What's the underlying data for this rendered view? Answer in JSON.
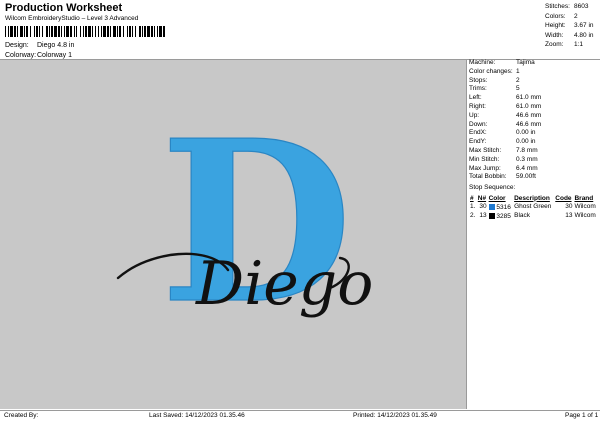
{
  "header": {
    "title": "Production Worksheet",
    "subtitle": "Wilcom EmbroideryStudio – Level 3 Advanced",
    "design_label": "Design:",
    "design_value": "Diego 4.8 in",
    "colorway_label": "Colorway:",
    "colorway_value": "Colorway 1"
  },
  "summary": [
    {
      "label": "Stitches:",
      "value": "8603"
    },
    {
      "label": "Colors:",
      "value": "2"
    },
    {
      "label": "Height:",
      "value": "3.67 in"
    },
    {
      "label": "Width:",
      "value": "4.80 in"
    },
    {
      "label": "Zoom:",
      "value": "1:1"
    }
  ],
  "details": [
    {
      "label": "Machine:",
      "value": "Tajima"
    },
    {
      "label": "Color changes:",
      "value": "1"
    },
    {
      "label": "Stops:",
      "value": "2"
    },
    {
      "label": "Trims:",
      "value": "5"
    },
    {
      "label": "Left:",
      "value": "61.0 mm"
    },
    {
      "label": "Right:",
      "value": "61.0 mm"
    },
    {
      "label": "Up:",
      "value": "46.6 mm"
    },
    {
      "label": "Down:",
      "value": "46.6 mm"
    },
    {
      "label": "EndX:",
      "value": "0.00 in"
    },
    {
      "label": "EndY:",
      "value": "0.00 in"
    },
    {
      "label": "Max Stitch:",
      "value": "7.8 mm"
    },
    {
      "label": "Min Stitch:",
      "value": "0.3 mm"
    },
    {
      "label": "Max Jump:",
      "value": "6.4 mm"
    },
    {
      "label": "Total Bobbin:",
      "value": "59.00ft"
    }
  ],
  "stop_sequence": {
    "title": "Stop Sequence:",
    "headers": {
      "index": "#",
      "n": "N#",
      "color": "Color",
      "description": "Description",
      "code": "Code",
      "brand": "Brand"
    },
    "rows": [
      {
        "index": "1.",
        "n": "30",
        "swatch": "#1e78d0",
        "color": "5316",
        "description": "Ghost Green",
        "code": "30",
        "brand": "Wilcom"
      },
      {
        "index": "2.",
        "n": "13",
        "swatch": "#000000",
        "color": "3285",
        "description": "Black",
        "code": "13",
        "brand": "Wilcom"
      }
    ]
  },
  "preview": {
    "background": "#c8c8c8",
    "letter": "D",
    "letter_color": "#3aa3e0",
    "script": "Diego",
    "script_color": "#111111"
  },
  "footer": {
    "created": "Created By:",
    "saved": "Last Saved: 14/12/2023 01.35.46",
    "printed": "Printed: 14/12/2023 01.35.49",
    "page": "Page 1 of 1"
  }
}
